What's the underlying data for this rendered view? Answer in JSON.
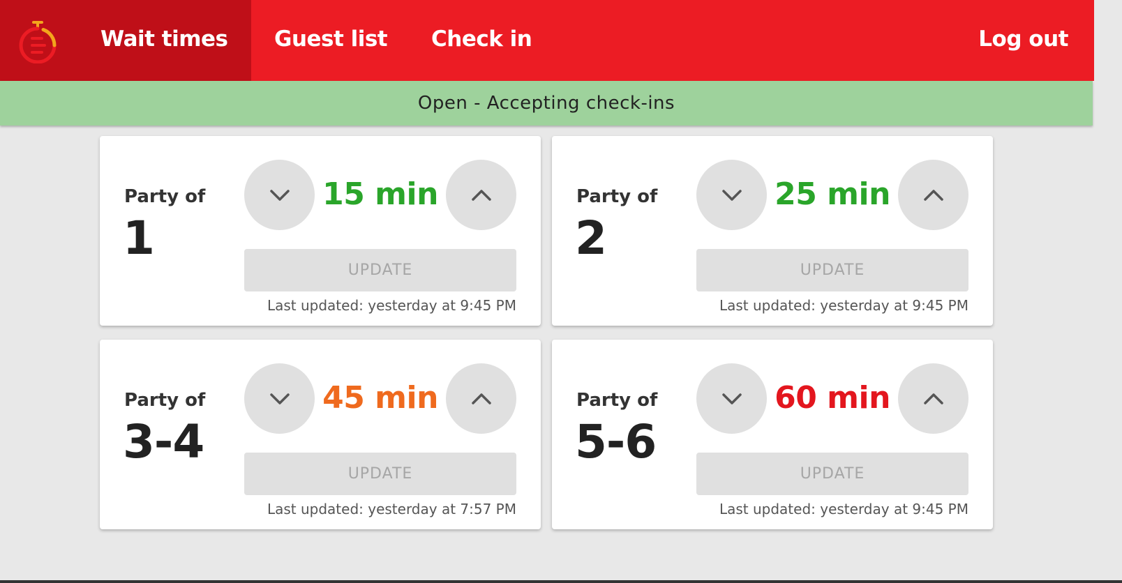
{
  "nav": {
    "logo_icon": "stopwatch-icon",
    "items": [
      {
        "label": "Wait times",
        "active": true
      },
      {
        "label": "Guest list",
        "active": false
      },
      {
        "label": "Check in",
        "active": false
      }
    ],
    "logout_label": "Log out"
  },
  "status": {
    "text": "Open - Accepting check-ins",
    "color": "#9ed29c"
  },
  "colors": {
    "brand_red": "#ec1c24",
    "active_nav": "#bf0f18",
    "green": "#2aa52a",
    "orange": "#ef6a1e",
    "red": "#e3161e"
  },
  "cards": [
    {
      "party_label": "Party of",
      "party_size": "1",
      "minutes": "15",
      "unit": "min",
      "color": "#2aa52a",
      "update_label": "UPDATE",
      "last_updated": "Last updated: yesterday at 9:45 PM"
    },
    {
      "party_label": "Party of",
      "party_size": "2",
      "minutes": "25",
      "unit": "min",
      "color": "#2aa52a",
      "update_label": "UPDATE",
      "last_updated": "Last updated: yesterday at 9:45 PM"
    },
    {
      "party_label": "Party of",
      "party_size": "3-4",
      "minutes": "45",
      "unit": "min",
      "color": "#ef6a1e",
      "update_label": "UPDATE",
      "last_updated": "Last updated: yesterday at 7:57 PM"
    },
    {
      "party_label": "Party of",
      "party_size": "5-6",
      "minutes": "60",
      "unit": "min",
      "color": "#e3161e",
      "update_label": "UPDATE",
      "last_updated": "Last updated: yesterday at 9:45 PM"
    }
  ]
}
